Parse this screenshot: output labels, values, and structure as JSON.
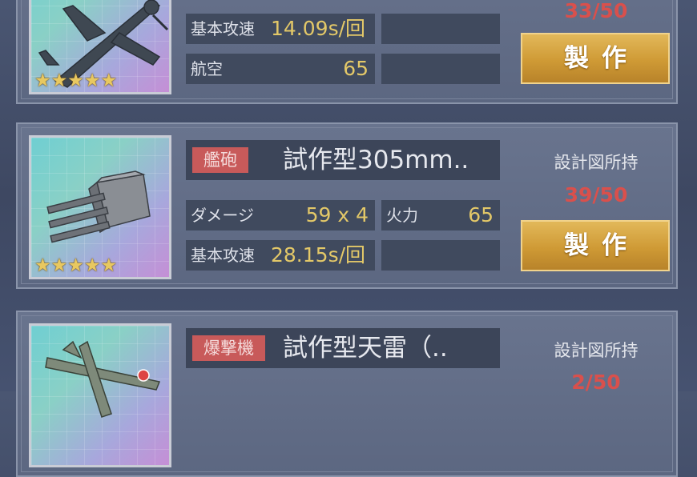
{
  "items": [
    {
      "stats": {
        "speed_label": "基本攻速",
        "speed_value": "14.09s/回",
        "air_label": "航空",
        "air_value": "65"
      },
      "blueprint_count": "33/50",
      "make_label": "製作",
      "stars": "★★★★★"
    },
    {
      "tag": "艦砲",
      "name": "試作型305mm..",
      "stats": {
        "damage_label": "ダメージ",
        "damage_value": "59 x 4",
        "firepower_label": "火力",
        "firepower_value": "65",
        "speed_label": "基本攻速",
        "speed_value": "28.15s/回"
      },
      "blueprint_label": "設計図所持",
      "blueprint_count": "39/50",
      "make_label": "製作",
      "stars": "★★★★★"
    },
    {
      "tag": "爆撃機",
      "name": "試作型天雷（..",
      "blueprint_label": "設計図所持",
      "blueprint_count": "2/50"
    }
  ],
  "colors": {
    "tag_red": "#c85a5a",
    "value_gold": "#e3c868",
    "count_red": "#d9504c",
    "button_gold": "#cf9a35"
  }
}
